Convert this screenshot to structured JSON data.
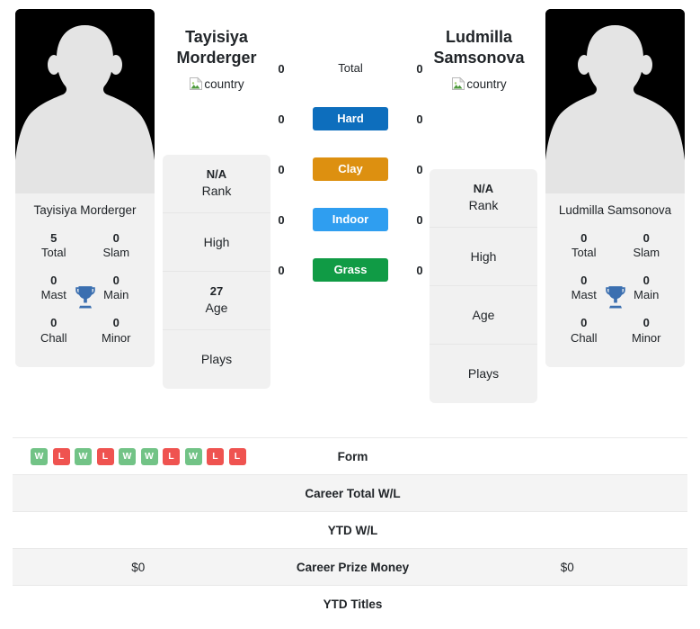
{
  "players": {
    "left": {
      "name": "Tayisiya Morderger",
      "first_name": "Tayisiya",
      "last_name": "Morderger",
      "country_alt": "country",
      "card_name": "Tayisiya Morderger",
      "titles": [
        {
          "value": "5",
          "label": "Total"
        },
        {
          "value": "0",
          "label": "Slam"
        },
        {
          "value": "0",
          "label": "Mast"
        },
        {
          "value": "0",
          "label": "Main"
        },
        {
          "value": "0",
          "label": "Chall"
        },
        {
          "value": "0",
          "label": "Minor"
        }
      ],
      "info": [
        {
          "value": "N/A",
          "label": "Rank"
        },
        {
          "value": "",
          "label": "High"
        },
        {
          "value": "27",
          "label": "Age"
        },
        {
          "value": "",
          "label": "Plays"
        }
      ]
    },
    "right": {
      "name": "Ludmilla Samsonova",
      "first_name": "Ludmilla",
      "last_name": "Samsonova",
      "country_alt": "country",
      "card_name": "Ludmilla Samsonova",
      "titles": [
        {
          "value": "0",
          "label": "Total"
        },
        {
          "value": "0",
          "label": "Slam"
        },
        {
          "value": "0",
          "label": "Mast"
        },
        {
          "value": "0",
          "label": "Main"
        },
        {
          "value": "0",
          "label": "Chall"
        },
        {
          "value": "0",
          "label": "Minor"
        }
      ],
      "info": [
        {
          "value": "N/A",
          "label": "Rank"
        },
        {
          "value": "",
          "label": "High"
        },
        {
          "value": "",
          "label": "Age"
        },
        {
          "value": "",
          "label": "Plays"
        }
      ]
    }
  },
  "surface_compare": [
    {
      "label": "Total",
      "left": "0",
      "right": "0",
      "color": "",
      "plain": true
    },
    {
      "label": "Hard",
      "left": "0",
      "right": "0",
      "color": "#0d6ebd",
      "plain": false
    },
    {
      "label": "Clay",
      "left": "0",
      "right": "0",
      "color": "#dd9010",
      "plain": false
    },
    {
      "label": "Indoor",
      "left": "0",
      "right": "0",
      "color": "#2f9ef0",
      "plain": false
    },
    {
      "label": "Grass",
      "left": "0",
      "right": "0",
      "color": "#109b45",
      "plain": false
    }
  ],
  "stats_table": [
    {
      "label": "Form",
      "type": "form",
      "left_form": [
        "W",
        "L",
        "W",
        "L",
        "W",
        "W",
        "L",
        "W",
        "L",
        "L"
      ],
      "right_form": [],
      "left": "",
      "right": "",
      "striped": false
    },
    {
      "label": "Career Total W/L",
      "type": "text",
      "left": "",
      "right": "",
      "striped": true
    },
    {
      "label": "YTD W/L",
      "type": "text",
      "left": "",
      "right": "",
      "striped": false
    },
    {
      "label": "Career Prize Money",
      "type": "text",
      "left": "$0",
      "right": "$0",
      "striped": true
    },
    {
      "label": "YTD Titles",
      "type": "text",
      "left": "",
      "right": "",
      "striped": false
    }
  ],
  "colors": {
    "win": "#72c386",
    "loss": "#ef5350",
    "trophy": "#3b6fb0",
    "card_bg": "#f1f1f1",
    "stripe": "#f4f4f4"
  }
}
